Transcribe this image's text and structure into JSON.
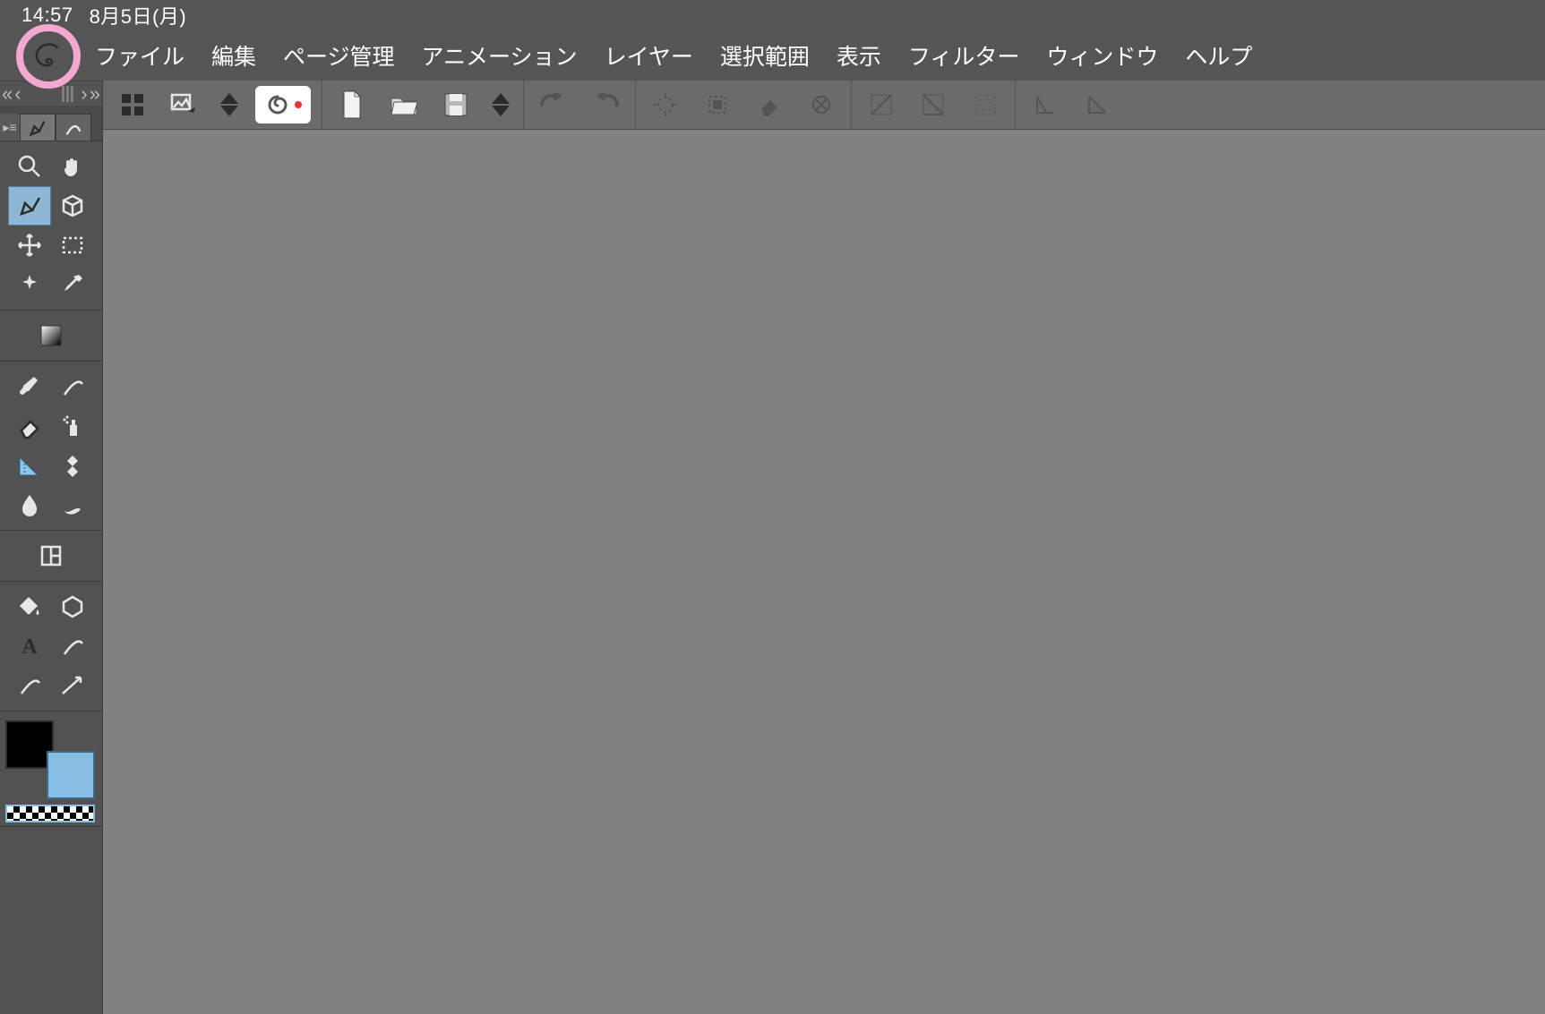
{
  "status": {
    "time": "14:57",
    "date": "8月5日(月)"
  },
  "menu": {
    "items": [
      {
        "label": "ファイル"
      },
      {
        "label": "編集"
      },
      {
        "label": "ページ管理"
      },
      {
        "label": "アニメーション"
      },
      {
        "label": "レイヤー"
      },
      {
        "label": "選択範囲"
      },
      {
        "label": "表示"
      },
      {
        "label": "フィルター"
      },
      {
        "label": "ウィンドウ"
      },
      {
        "label": "ヘルプ"
      }
    ]
  },
  "annotation": {
    "highlight_target": "app-logo",
    "highlight_color": "#f3a8cf"
  },
  "command_bar": {
    "groups": [
      {
        "items": [
          "clip-studio-start-icon",
          "quick-share-icon",
          "canvas-step-icon",
          "clip-record-icon"
        ]
      },
      {
        "items": [
          "new-file-icon",
          "open-file-icon",
          "save-icon",
          "save-step-icon"
        ]
      },
      {
        "items": [
          "undo-icon",
          "redo-icon"
        ],
        "disabled": true
      },
      {
        "items": [
          "deselect-icon",
          "select-crop-icon",
          "clear-icon",
          "fill-selection-icon"
        ],
        "disabled": true
      },
      {
        "items": [
          "tone-curve-icon",
          "levels-icon",
          "grid-icon"
        ],
        "disabled": true
      },
      {
        "items": [
          "snap-border-icon",
          "snap-angle-icon"
        ],
        "disabled": true
      }
    ]
  },
  "tool_palette": {
    "blocks": [
      {
        "kind": "pair",
        "items": [
          {
            "name": "zoom-tool",
            "icon": "magnifier-icon",
            "selected": false
          },
          {
            "name": "hand-tool",
            "icon": "hand-icon",
            "selected": false
          },
          {
            "name": "pen-tool",
            "icon": "pen-nib-icon",
            "selected": true
          },
          {
            "name": "object-3d-tool",
            "icon": "cube-icon",
            "selected": false
          },
          {
            "name": "move-tool",
            "icon": "move-arrows-icon",
            "selected": false
          },
          {
            "name": "marquee-tool",
            "icon": "dashed-rect-icon",
            "selected": false
          },
          {
            "name": "magic-wand-tool",
            "icon": "wand-sparkle-icon",
            "selected": false
          },
          {
            "name": "eyedropper-tool",
            "icon": "eyedropper-icon",
            "selected": false
          }
        ]
      },
      {
        "kind": "single",
        "items": [
          {
            "name": "gradient-swatch",
            "icon": "gradient-square-icon",
            "selected": false
          }
        ]
      },
      {
        "kind": "pair",
        "items": [
          {
            "name": "brush-tool",
            "icon": "brush-icon",
            "selected": false
          },
          {
            "name": "tail-brush-tool",
            "icon": "curve-tail-icon",
            "selected": false
          },
          {
            "name": "eraser-tool",
            "icon": "eraser-icon",
            "selected": false
          },
          {
            "name": "airbrush-tool",
            "icon": "spray-icon",
            "selected": false
          },
          {
            "name": "ruler-tool",
            "icon": "ruler-triangle-icon",
            "selected": false
          },
          {
            "name": "pattern-tool",
            "icon": "diamond-grid-icon",
            "selected": false
          },
          {
            "name": "blur-tool",
            "icon": "droplet-icon",
            "selected": false
          },
          {
            "name": "blend-tool",
            "icon": "smudge-icon",
            "selected": false
          }
        ]
      },
      {
        "kind": "single",
        "items": [
          {
            "name": "panel-frame-tool",
            "icon": "panel-frame-icon",
            "selected": false
          }
        ]
      },
      {
        "kind": "pair",
        "items": [
          {
            "name": "fill-tool",
            "icon": "paint-bucket-icon",
            "selected": false
          },
          {
            "name": "shape-tool",
            "icon": "hexagon-icon",
            "selected": false
          },
          {
            "name": "text-tool",
            "icon": "letter-a-icon",
            "selected": false
          },
          {
            "name": "balloon-tail-tool",
            "icon": "curve-tail-icon",
            "selected": false
          },
          {
            "name": "saturated-line-tool",
            "icon": "curve-tail-icon",
            "selected": false
          },
          {
            "name": "stream-line-tool",
            "icon": "arrow-guide-icon",
            "selected": false
          }
        ]
      }
    ]
  },
  "colors": {
    "foreground": "#000000",
    "background": "#86bde0",
    "transparent_selected": true
  }
}
